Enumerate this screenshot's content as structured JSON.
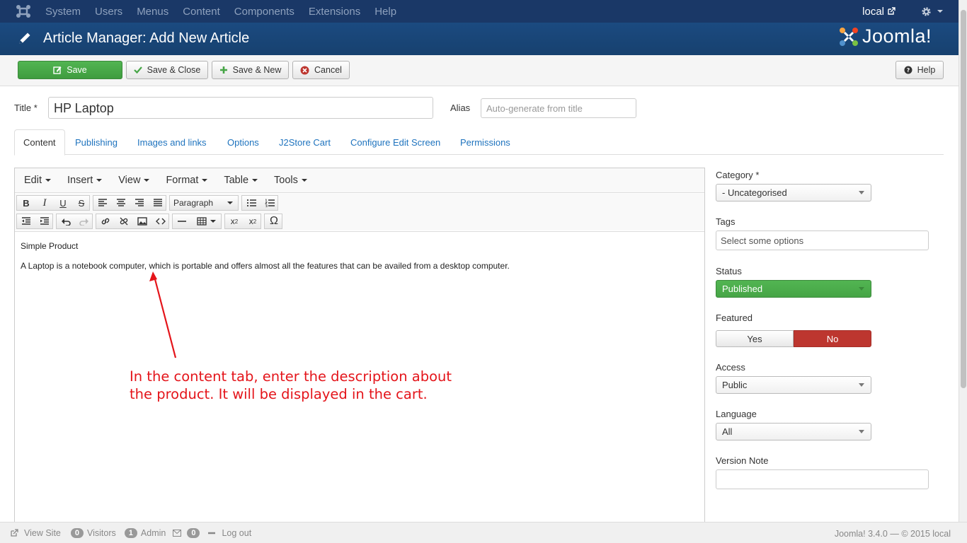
{
  "topbar": {
    "menu": [
      "System",
      "Users",
      "Menus",
      "Content",
      "Components",
      "Extensions",
      "Help"
    ],
    "site_name": "local"
  },
  "header": {
    "title": "Article Manager: Add New Article",
    "brand": "Joomla!"
  },
  "toolbar": {
    "save": "Save",
    "save_close": "Save & Close",
    "save_new": "Save & New",
    "cancel": "Cancel",
    "help": "Help"
  },
  "form": {
    "title_label": "Title *",
    "title_value": "HP Laptop",
    "alias_label": "Alias",
    "alias_placeholder": "Auto-generate from title"
  },
  "tabs": [
    "Content",
    "Publishing",
    "Images and links",
    "Options",
    "J2Store Cart",
    "Configure Edit Screen",
    "Permissions"
  ],
  "editor": {
    "menus": [
      "Edit",
      "Insert",
      "View",
      "Format",
      "Table",
      "Tools"
    ],
    "format_select": "Paragraph",
    "heading_line": "Simple Product",
    "body_line": "A Laptop is a notebook computer, which is portable and offers almost all the features that can be availed from a desktop computer."
  },
  "annotation": {
    "line1": "In the content tab, enter the description about",
    "line2": "the product. It will be displayed in the cart.",
    "color": "#e4141a"
  },
  "sidebar": {
    "category_label": "Category *",
    "category_value": "- Uncategorised",
    "tags_label": "Tags",
    "tags_placeholder": "Select some options",
    "status_label": "Status",
    "status_value": "Published",
    "featured_label": "Featured",
    "featured_yes": "Yes",
    "featured_no": "No",
    "access_label": "Access",
    "access_value": "Public",
    "language_label": "Language",
    "language_value": "All",
    "version_note_label": "Version Note"
  },
  "footer": {
    "view_site": "View Site",
    "visitors_count": "0",
    "visitors_label": "Visitors",
    "admin_count": "1",
    "admin_label": "Admin",
    "messages_count": "0",
    "logout": "Log out",
    "version": "Joomla! 3.4.0  —  © 2015 local"
  },
  "colors": {
    "topbar": "#1a3867",
    "header": "#17416f",
    "save_green": "#46a546",
    "published_green": "#46a546",
    "no_red": "#bd362f",
    "link_blue": "#1e73be"
  }
}
